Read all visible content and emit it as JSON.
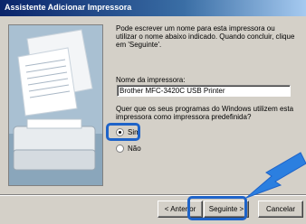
{
  "window": {
    "title": "Assistente Adicionar Impressora"
  },
  "wizard": {
    "intro": "Pode escrever um nome para esta impressora ou utilizar o nome abaixo indicado. Quando concluir, clique em 'Seguinte'.",
    "printer_name_label": "Nome da impressora:",
    "printer_name_value": "Brother MFC-3420C USB Printer",
    "default_question": "Quer que os seus programas do Windows utilizem esta impressora como impressora predefinida?",
    "default_options": [
      {
        "label": "Sim",
        "selected": true
      },
      {
        "label": "Não",
        "selected": false
      }
    ]
  },
  "buttons": {
    "back": "< Anterior",
    "next": "Seguinte >",
    "cancel": "Cancelar"
  },
  "highlight": {
    "color": "#1e63c8",
    "arrow_color": "#2b7fe0"
  }
}
